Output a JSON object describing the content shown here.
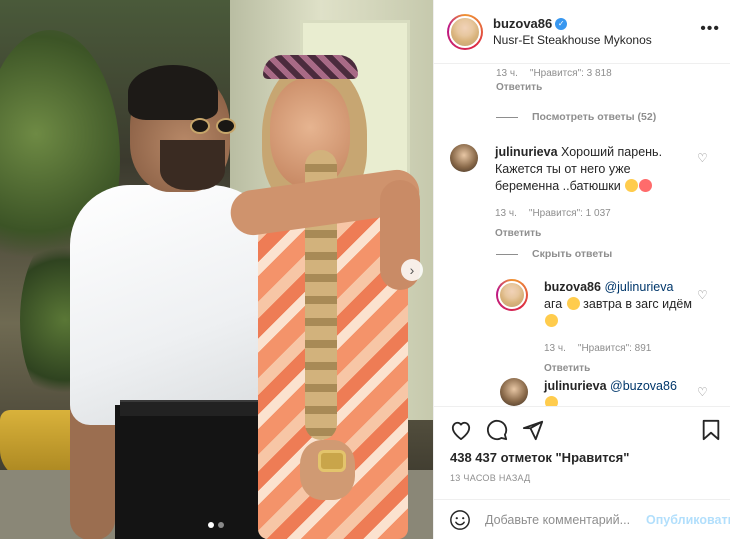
{
  "post": {
    "username": "buzova86",
    "location": "Nusr-Et Steakhouse Mykonos",
    "more_label": "•••"
  },
  "carousel": {
    "slide_count": 2,
    "active_slide": 1,
    "next_glyph": "›"
  },
  "comments": {
    "top_meta": {
      "time": "13 ч.",
      "likes": "\"Нравится\": 3 818",
      "reply": "Ответить"
    },
    "view_replies": "Посмотреть ответы (52)",
    "comment1": {
      "user": "julinurieva",
      "text": "Хороший парень. Кажется ты от него уже беременна ..батюшки",
      "time": "13 ч.",
      "likes": "\"Нравится\": 1 037",
      "reply": "Ответить"
    },
    "hide_replies": "Скрыть ответы",
    "reply1": {
      "user": "buzova86",
      "mention": "@julinurieva",
      "text_a": "ага",
      "text_b": "завтра в загс идём",
      "time": "13 ч.",
      "likes": "\"Нравится\": 891",
      "reply": "Ответить"
    },
    "reply2": {
      "user": "julinurieva",
      "mention": "@buzova86"
    }
  },
  "actions": {
    "likes_text": "438 437 отметок \"Нравится\"",
    "time_ago": "13 ЧАСОВ НАЗАД"
  },
  "add_comment": {
    "placeholder": "Добавьте комментарий...",
    "publish_label": "Опубликовать"
  },
  "colors": {
    "accent": "#3897f0",
    "publish_disabled": "#b2dffc",
    "muted": "#8e8e8e"
  },
  "icons": [
    "more-icon",
    "next-arrow-icon",
    "heart-icon",
    "comment-icon",
    "share-icon",
    "bookmark-icon",
    "smile-icon",
    "verified-icon"
  ]
}
